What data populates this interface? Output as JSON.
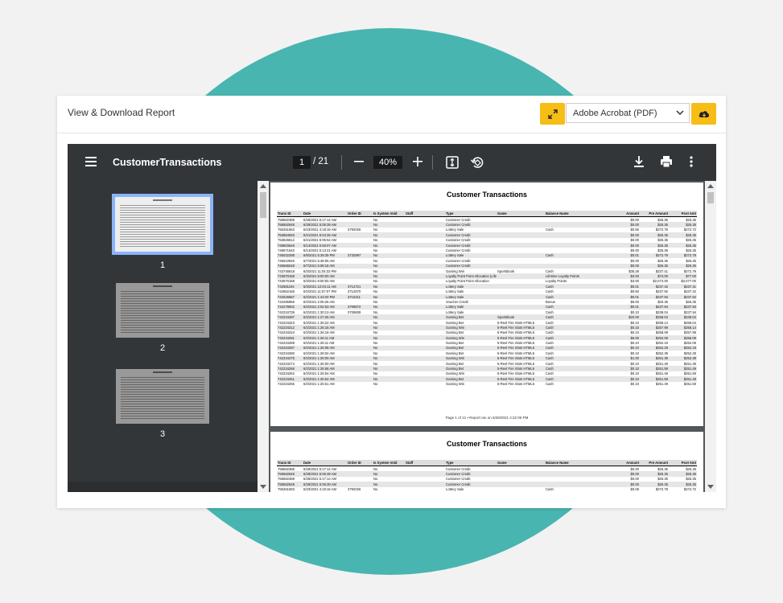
{
  "header": {
    "title": "View & Download Report",
    "format_selected": "Adobe Acrobat (PDF)"
  },
  "viewer": {
    "doc_title": "CustomerTransactions",
    "current_page": "1",
    "total_pages": "/ 21",
    "zoom": "40%",
    "thumbnails": [
      "1",
      "2",
      "3"
    ]
  },
  "report": {
    "heading": "Customer Transactions",
    "columns": [
      "Trans ID",
      "Date",
      "Order ID",
      "Is System Void",
      "Staff",
      "Type",
      "Game",
      "Balance Name",
      "Amount",
      "Pre Amount",
      "Post Amt"
    ],
    "rows": [
      [
        "758582388",
        "6/28/2021 5:17:14 AM",
        "",
        "No",
        "",
        "Customer Credit",
        "",
        "",
        "$0.00",
        "$25.35",
        "$25.35"
      ],
      [
        "758582848",
        "6/28/2021 5:06:39 AM",
        "",
        "No",
        "",
        "Customer Credit",
        "",
        "",
        "$0.00",
        "$25.35",
        "$25.35"
      ],
      [
        "755261583",
        "6/23/2021 4:18:16 AM",
        "3792026",
        "No",
        "",
        "Lottery Sale",
        "",
        "Cash",
        "$0.56",
        "$272.78",
        "$272.72"
      ],
      [
        "753864925",
        "6/21/2021 6:04:26 AM",
        "",
        "No",
        "",
        "Customer Credit",
        "",
        "",
        "$0.00",
        "$25.35",
        "$25.35"
      ],
      [
        "753826612",
        "6/21/2021 5:05:54 AM",
        "",
        "No",
        "",
        "Customer Credit",
        "",
        "",
        "$0.00",
        "$25.35",
        "$25.35"
      ],
      [
        "748603646",
        "6/14/2021 5:56:07 AM",
        "",
        "No",
        "",
        "Customer Credit",
        "",
        "",
        "$0.00",
        "$25.35",
        "$25.35"
      ],
      [
        "748671542",
        "6/14/2021 5:13:21 AM",
        "",
        "No",
        "",
        "Customer Credit",
        "",
        "",
        "$0.00",
        "$25.35",
        "$25.35"
      ],
      [
        "746032298",
        "6/8/2021 5:39:39 PM",
        "3732897",
        "No",
        "",
        "Lottery Sale",
        "",
        "Cash",
        "$0.01",
        "$272.79",
        "$272.78"
      ],
      [
        "745610925",
        "6/7/2021 5:38:05 AM",
        "",
        "No",
        "",
        "Customer Credit",
        "",
        "",
        "$0.00",
        "$25.35",
        "$25.35"
      ],
      [
        "745588248",
        "6/7/2021 5:08:18 AM",
        "",
        "No",
        "",
        "Customer Credit",
        "",
        "",
        "$0.00",
        "$25.35",
        "$25.35"
      ],
      [
        "743745818",
        "6/3/2021 11:04:33 PM",
        "",
        "No",
        "",
        "Gaming Win",
        "Sportsbook",
        "Cash",
        "$35.28",
        "$237.41",
        "$272.79"
      ],
      [
        "743670168",
        "6/3/2021 8:00:00 AM",
        "",
        "No",
        "",
        "Loyalty Point Point Allocation (Lifetime Points)",
        "",
        "Lifetime Loyalty Points",
        "$3.00",
        "$74.00",
        "$77.00"
      ],
      [
        "743670168",
        "6/3/2021 8:00:00 AM",
        "",
        "No",
        "",
        "Loyalty Point Point Allocation",
        "",
        "Loyalty Points",
        "$3.00",
        "$2,074.00",
        "$2,077.00"
      ],
      [
        "742681194",
        "6/3/2021 12:04:11 AM",
        "3712721",
        "No",
        "",
        "Lottery Sale",
        "",
        "Cash",
        "$0.01",
        "$237.42",
        "$237.41"
      ],
      [
        "742652158",
        "6/2/2021 11:57:07 PM",
        "3712670",
        "No",
        "",
        "Lottery Sale",
        "",
        "Cash",
        "$0.50",
        "$237.92",
        "$237.42"
      ],
      [
        "742526687",
        "6/2/2021 1:43:20 PM",
        "3710211",
        "No",
        "",
        "Lottery Sale",
        "",
        "Cash",
        "$0.01",
        "$237.93",
        "$237.92"
      ],
      [
        "742285956",
        "6/2/2021 2:05:26 AM",
        "",
        "No",
        "",
        "Voucher Credit",
        "",
        "Bonus",
        "$5.00",
        "$20.35",
        "$25.35"
      ],
      [
        "742278602",
        "6/2/2021 2:02:53 AM",
        "3708672",
        "No",
        "",
        "Lottery Sale",
        "",
        "Cash",
        "$0.01",
        "$237.94",
        "$237.93"
      ],
      [
        "742234739",
        "6/2/2021 1:30:13 AM",
        "3708609",
        "No",
        "",
        "Lottery Sale",
        "",
        "Cash",
        "$0.10",
        "$238.04",
        "$237.94"
      ],
      [
        "742234497",
        "6/2/2021 1:27:26 AM",
        "",
        "No",
        "",
        "Gaming Bet",
        "Sportsbook",
        "Cash",
        "$20.00",
        "$258.04",
        "$238.04"
      ],
      [
        "742234323",
        "6/2/2021 1:26:22 AM",
        "",
        "No",
        "",
        "Gaming Bet",
        "5-Reel Fire Slots HTML5",
        "Cash",
        "$0.10",
        "$258.14",
        "$258.04"
      ],
      [
        "742234312",
        "6/2/2021 1:26:18 AM",
        "",
        "No",
        "",
        "Gaming Win",
        "5-Reel Fire Slots HTML5",
        "Cash",
        "$0.15",
        "$257.99",
        "$258.14"
      ],
      [
        "742234310",
        "6/2/2021 1:26:18 AM",
        "",
        "No",
        "",
        "Gaming Bet",
        "5-Reel Fire Slots HTML5",
        "Cash",
        "$0.10",
        "$258.09",
        "$257.99"
      ],
      [
        "742234291",
        "6/2/2021 1:26:11 AM",
        "",
        "No",
        "",
        "Gaming Win",
        "5-Reel Fire Slots HTML5",
        "Cash",
        "$6.00",
        "$252.09",
        "$258.09"
      ],
      [
        "742234289",
        "6/2/2021 1:26:11 AM",
        "",
        "No",
        "",
        "Gaming Bet",
        "5-Reel Fire Slots HTML5",
        "Cash",
        "$0.10",
        "$252.19",
        "$252.09"
      ],
      [
        "742234287",
        "6/2/2021 1:26:08 AM",
        "",
        "No",
        "",
        "Gaming Bet",
        "5-Reel Fire Slots HTML5",
        "Cash",
        "$0.10",
        "$252.29",
        "$252.19"
      ],
      [
        "742234280",
        "6/2/2021 1:26:04 AM",
        "",
        "No",
        "",
        "Gaming Bet",
        "5-Reel Fire Slots HTML5",
        "Cash",
        "$0.10",
        "$252.39",
        "$252.29"
      ],
      [
        "742234275",
        "6/2/2021 1:26:00 AM",
        "",
        "No",
        "",
        "Gaming Win",
        "5-Reel Fire Slots HTML5",
        "Cash",
        "$1.00",
        "$251.39",
        "$252.39"
      ],
      [
        "742234274",
        "6/2/2021 1:26:00 AM",
        "",
        "No",
        "",
        "Gaming Bet",
        "5-Reel Fire Slots HTML5",
        "Cash",
        "$0.10",
        "$251.49",
        "$251.39"
      ],
      [
        "742234266",
        "6/2/2021 1:25:58 AM",
        "",
        "No",
        "",
        "Gaming Bet",
        "5-Reel Fire Slots HTML5",
        "Cash",
        "$0.10",
        "$251.59",
        "$251.49"
      ],
      [
        "742234262",
        "6/2/2021 1:25:54 AM",
        "",
        "No",
        "",
        "Gaming Win",
        "5-Reel Fire Slots HTML5",
        "Cash",
        "$0.10",
        "$251.49",
        "$251.59"
      ],
      [
        "742234261",
        "6/2/2021 1:25:54 AM",
        "",
        "No",
        "",
        "Gaming Bet",
        "5-Reel Fire Slots HTML5",
        "Cash",
        "$0.10",
        "$251.59",
        "$251.49"
      ],
      [
        "742234255",
        "6/2/2021 1:25:51 AM",
        "",
        "No",
        "",
        "Gaming Win",
        "5-Reel Fire Slots HTML5",
        "Cash",
        "$0.10",
        "$251.49",
        "$251.59"
      ]
    ],
    "footer": "Page 1 of 21  •  Report ran on 6/28/2021 4:22:06 PM",
    "page2_rows": [
      [
        "758582388",
        "6/28/2021 5:17:14 AM",
        "",
        "No",
        "",
        "Customer Credit",
        "",
        "",
        "$0.00",
        "$25.35",
        "$25.35"
      ],
      [
        "758582848",
        "6/28/2021 5:06:39 AM",
        "",
        "No",
        "",
        "Customer Credit",
        "",
        "",
        "$0.00",
        "$25.35",
        "$25.35"
      ],
      [
        "758582388",
        "6/28/2021 5:17:14 AM",
        "",
        "No",
        "",
        "Customer Credit",
        "",
        "",
        "$0.00",
        "$25.35",
        "$25.35"
      ],
      [
        "758582848",
        "6/28/2021 5:06:39 AM",
        "",
        "No",
        "",
        "Customer Credit",
        "",
        "",
        "$0.00",
        "$25.35",
        "$25.35"
      ],
      [
        "755261583",
        "6/23/2021 4:18:16 AM",
        "3792026",
        "No",
        "",
        "Lottery Sale",
        "",
        "Cash",
        "$0.06",
        "$272.78",
        "$272.72"
      ]
    ]
  },
  "colors": {
    "accent": "#f6bd16",
    "teal": "#48b5b0",
    "toolbar": "#323639",
    "viewer_bg": "#525659"
  }
}
